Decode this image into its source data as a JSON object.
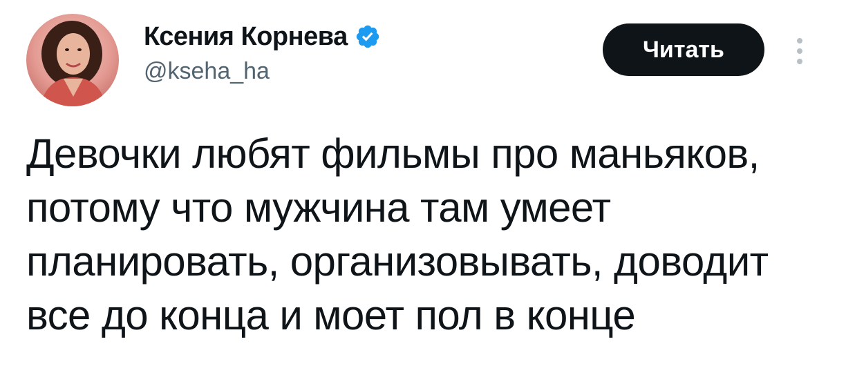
{
  "author": {
    "display_name": "Ксения Корнева",
    "handle": "@kseha_ha",
    "verified": true,
    "verified_color": "#1d9bf0",
    "avatar_icon": "profile-photo"
  },
  "actions": {
    "follow_label": "Читать",
    "more_icon": "more-vertical-icon"
  },
  "tweet": {
    "lines": [
      "Девочки любят фильмы про маньяков,",
      "потому что мужчина там умеет",
      "планировать, организовывать, доводит",
      "все до конца и моет пол в конце"
    ]
  },
  "colors": {
    "text": "#0f1419",
    "secondary": "#536471",
    "button_bg": "#0f1419",
    "button_text": "#ffffff"
  }
}
